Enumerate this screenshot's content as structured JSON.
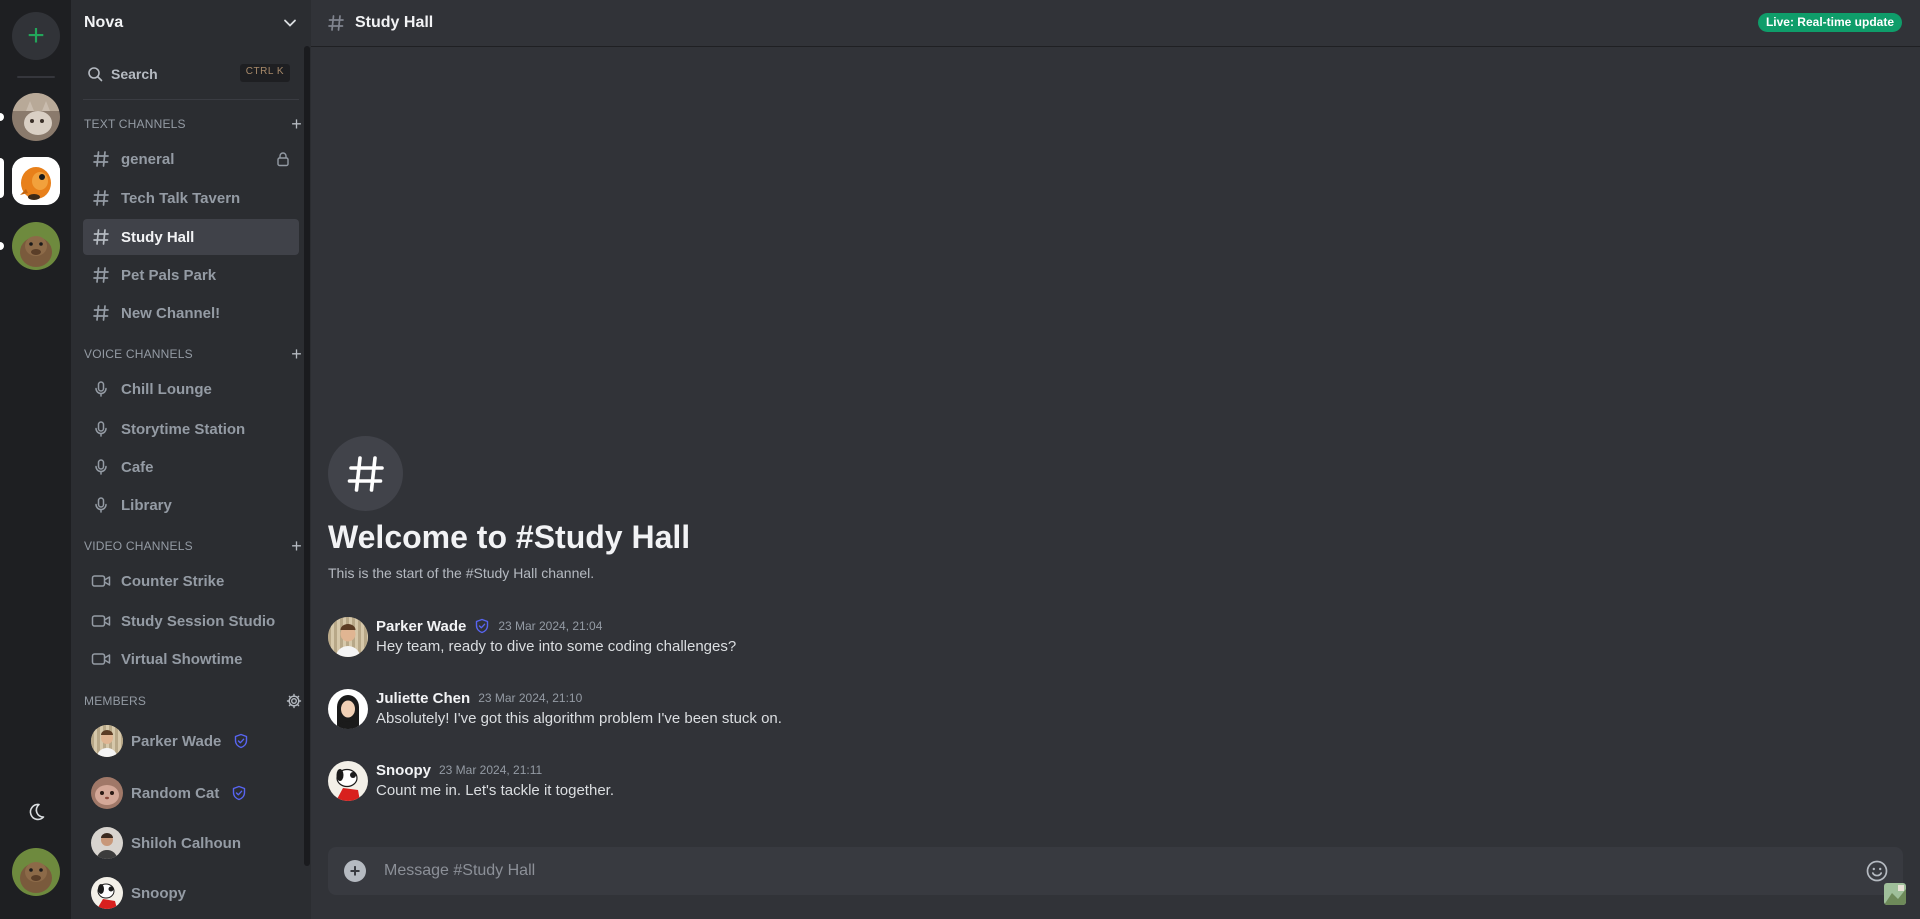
{
  "server": {
    "name": "Nova"
  },
  "search": {
    "label": "Search",
    "shortcut": "CTRL K"
  },
  "categories": {
    "text": "TEXT CHANNELS",
    "voice": "VOICE CHANNELS",
    "video": "VIDEO CHANNELS",
    "members": "MEMBERS"
  },
  "text_channels": [
    {
      "name": "general",
      "locked": true
    },
    {
      "name": "Tech Talk Tavern"
    },
    {
      "name": "Study Hall",
      "selected": true
    },
    {
      "name": "Pet Pals Park"
    },
    {
      "name": "New Channel!"
    }
  ],
  "voice_channels": [
    {
      "name": "Chill Lounge"
    },
    {
      "name": "Storytime Station"
    },
    {
      "name": "Cafe"
    },
    {
      "name": "Library"
    }
  ],
  "video_channels": [
    {
      "name": "Counter Strike"
    },
    {
      "name": "Study Session Studio"
    },
    {
      "name": "Virtual Showtime"
    }
  ],
  "members": [
    {
      "name": "Parker Wade",
      "verified": true
    },
    {
      "name": "Random Cat",
      "verified": true
    },
    {
      "name": "Shiloh Calhoun",
      "verified": false
    },
    {
      "name": "Snoopy",
      "verified": false
    }
  ],
  "channel_header": {
    "title": "Study Hall",
    "live_badge": "Live: Real-time update"
  },
  "welcome": {
    "title": "Welcome to #Study Hall",
    "subtitle": "This is the start of the #Study Hall channel."
  },
  "messages": [
    {
      "author": "Parker Wade",
      "verified": true,
      "time": "23 Mar 2024, 21:04",
      "text": "Hey team, ready to dive into some coding challenges?"
    },
    {
      "author": "Juliette Chen",
      "verified": false,
      "time": "23 Mar 2024, 21:10",
      "text": "Absolutely! I've got this algorithm problem I've been stuck on."
    },
    {
      "author": "Snoopy",
      "verified": false,
      "time": "23 Mar 2024, 21:11",
      "text": "Count me in. Let's tackle it together."
    }
  ],
  "composer": {
    "placeholder": "Message #Study Hall"
  },
  "colors": {
    "accent_green": "#23a55a",
    "live_badge": "#0f9d6a",
    "verified": "#5865f2"
  },
  "icons": {
    "add_server": "plus-icon",
    "theme": "moon-icon",
    "text_channel": "hash-icon",
    "voice_channel": "microphone-icon",
    "video_channel": "video-camera-icon",
    "members_settings": "gear-icon",
    "verified": "shield-check-icon",
    "emoji": "smiley-icon"
  }
}
